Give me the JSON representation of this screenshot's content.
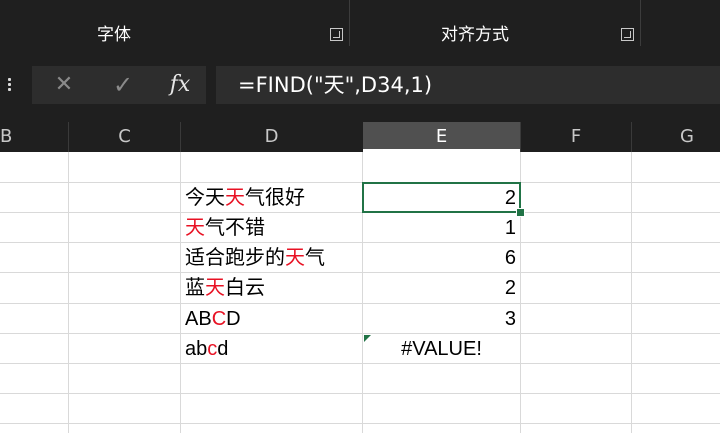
{
  "ribbon": {
    "groups": [
      {
        "label": "字体"
      },
      {
        "label": "对齐方式"
      }
    ]
  },
  "formula_bar": {
    "cancel_icon": "✕",
    "enter_icon": "✓",
    "fx_label": "fx",
    "formula": "=FIND(\"天\",D34,1)"
  },
  "columns": [
    "B",
    "C",
    "D",
    "E",
    "F",
    "G"
  ],
  "selected_column": "E",
  "rows": [
    {
      "d": [
        {
          "t": "今"
        },
        {
          "t": "天"
        },
        {
          "t": "天",
          "hl": true
        },
        {
          "t": "气很好"
        }
      ],
      "e": "2"
    },
    {
      "d": [
        {
          "t": "天",
          "hl": true
        },
        {
          "t": "气不错"
        }
      ],
      "e": "1"
    },
    {
      "d": [
        {
          "t": "适合跑步的"
        },
        {
          "t": "天",
          "hl": true
        },
        {
          "t": "气"
        }
      ],
      "e": "6"
    },
    {
      "d": [
        {
          "t": "蓝"
        },
        {
          "t": "天",
          "hl": true
        },
        {
          "t": "白云"
        }
      ],
      "e": "2"
    },
    {
      "d": [
        {
          "t": "AB"
        },
        {
          "t": "C",
          "hl": true
        },
        {
          "t": "D"
        }
      ],
      "e": "3"
    },
    {
      "d": [
        {
          "t": "ab"
        },
        {
          "t": "c",
          "hl": true
        },
        {
          "t": "d"
        }
      ],
      "e": "#VALUE!",
      "error": true
    }
  ],
  "colors": {
    "highlight": "#e81123",
    "selection": "#217346",
    "ribbon_bg": "#1f1f1f"
  }
}
